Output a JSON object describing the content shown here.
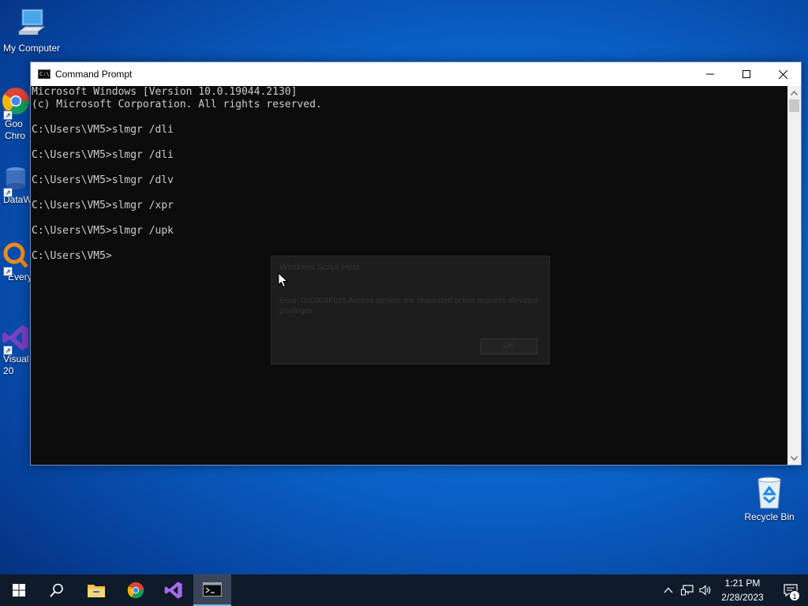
{
  "desktop": {
    "icons": [
      {
        "label": "My Computer"
      },
      {
        "label": "Goo\nChro"
      },
      {
        "label": "DataW"
      },
      {
        "label": "Every"
      },
      {
        "label": "Visual\n20"
      },
      {
        "label": "Recycle Bin"
      }
    ]
  },
  "window": {
    "title": "Command Prompt",
    "console_lines": [
      "Microsoft Windows [Version 10.0.19044.2130]",
      "(c) Microsoft Corporation. All rights reserved.",
      "",
      "C:\\Users\\VM5>slmgr /dli",
      "",
      "C:\\Users\\VM5>slmgr /dli",
      "",
      "C:\\Users\\VM5>slmgr /dlv",
      "",
      "C:\\Users\\VM5>slmgr /xpr",
      "",
      "C:\\Users\\VM5>slmgr /upk",
      "",
      "C:\\Users\\VM5>"
    ]
  },
  "dialog": {
    "title": "Windows Script Host",
    "message": "Error: 0xC004F025 Access denied: the requested action requires elevated privileges",
    "ok_label": "OK"
  },
  "taskbar": {
    "time": "1:21 PM",
    "date": "2/28/2023",
    "notification_count": "1"
  },
  "colors": {
    "console_bg": "#0c0c0c",
    "console_text": "#cccccc",
    "taskbar_bg": "#0f1a2a"
  }
}
